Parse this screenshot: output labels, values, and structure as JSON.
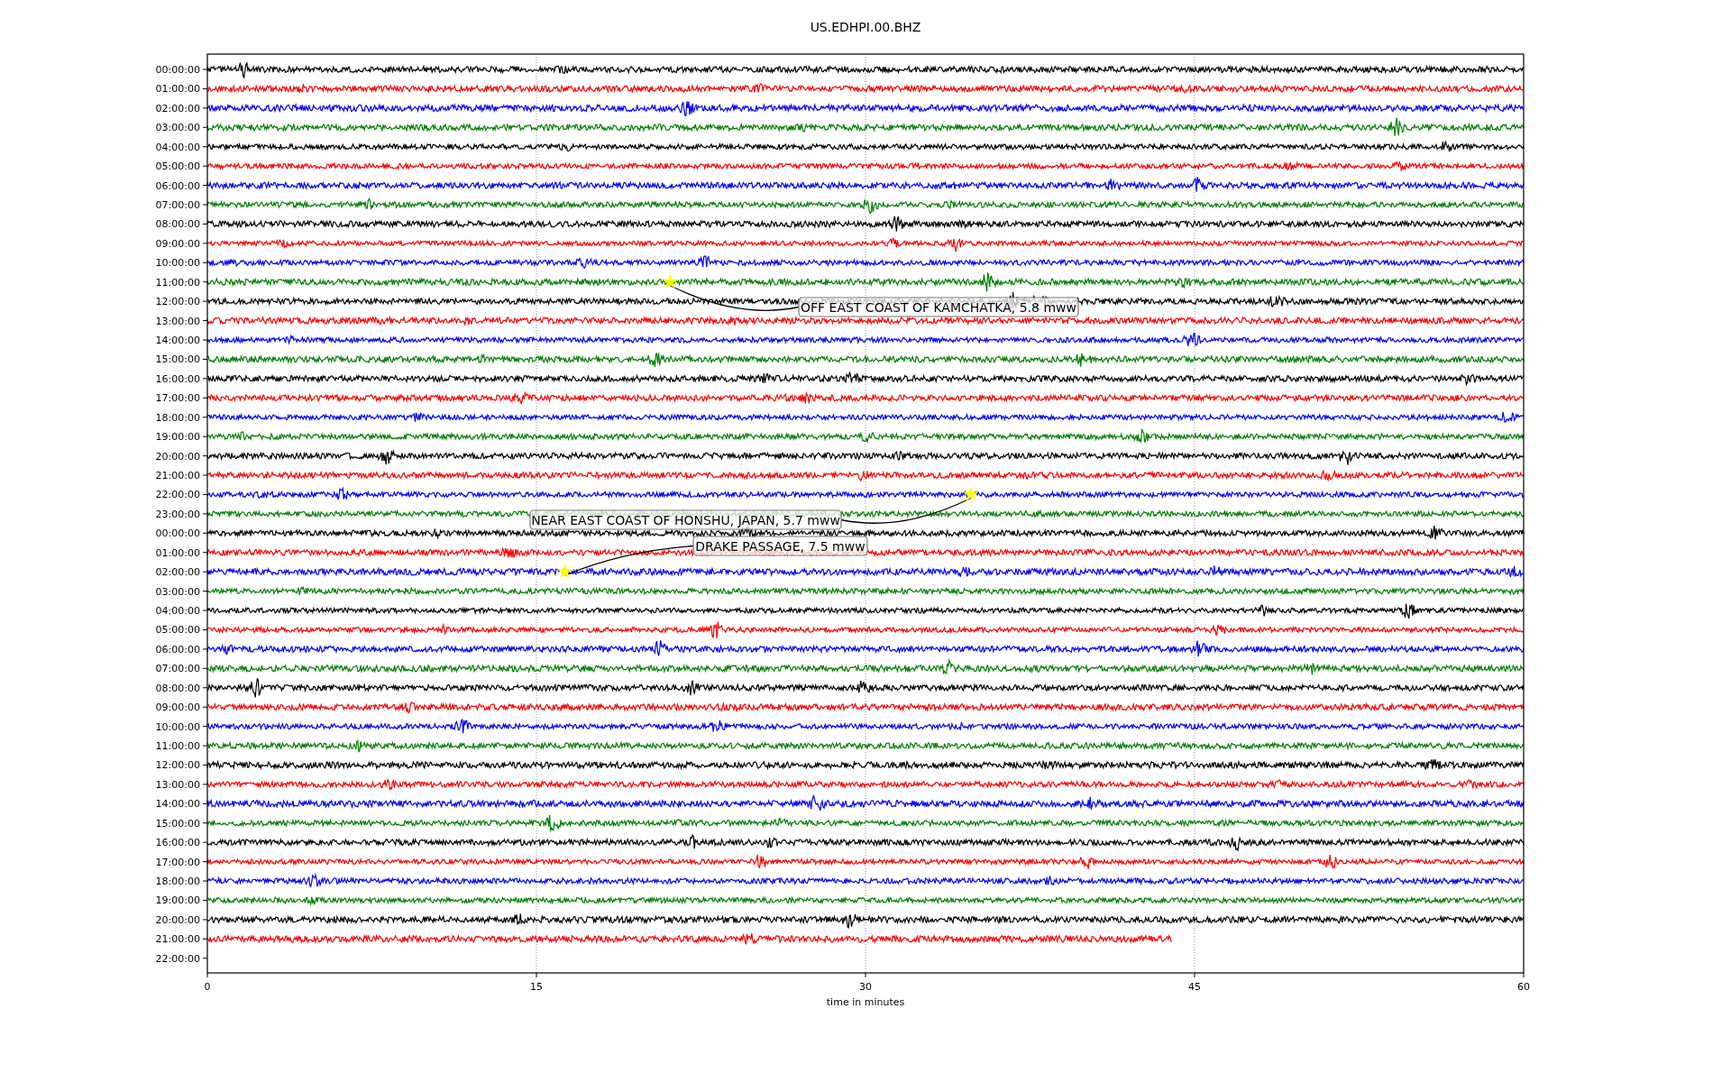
{
  "title": "US.EDHPI.00.BHZ",
  "x_axis": {
    "label": "time in minutes",
    "ticks": [
      "0",
      "15",
      "30",
      "45",
      "60"
    ]
  },
  "traces": [
    {
      "label": "00:00:00",
      "color": "#000000",
      "level": 1
    },
    {
      "label": "01:00:00",
      "color": "#ff0000",
      "level": 1
    },
    {
      "label": "02:00:00",
      "color": "#0000ff",
      "level": 1
    },
    {
      "label": "03:00:00",
      "color": "#008000",
      "level": 1
    },
    {
      "label": "04:00:00",
      "color": "#000000",
      "level": 1
    },
    {
      "label": "05:00:00",
      "color": "#ff0000",
      "level": 1
    },
    {
      "label": "06:00:00",
      "color": "#0000ff",
      "level": 1
    },
    {
      "label": "07:00:00",
      "color": "#008000",
      "level": 1
    },
    {
      "label": "08:00:00",
      "color": "#000000",
      "level": 1
    },
    {
      "label": "09:00:00",
      "color": "#ff0000",
      "level": 1
    },
    {
      "label": "10:00:00",
      "color": "#0000ff",
      "level": 1
    },
    {
      "label": "11:00:00",
      "color": "#008000",
      "level": 1
    },
    {
      "label": "12:00:00",
      "color": "#000000",
      "level": 1
    },
    {
      "label": "13:00:00",
      "color": "#ff0000",
      "level": 1
    },
    {
      "label": "14:00:00",
      "color": "#0000ff",
      "level": 1
    },
    {
      "label": "15:00:00",
      "color": "#008000",
      "level": 1
    },
    {
      "label": "16:00:00",
      "color": "#000000",
      "level": 1
    },
    {
      "label": "17:00:00",
      "color": "#ff0000",
      "level": 1
    },
    {
      "label": "18:00:00",
      "color": "#0000ff",
      "level": 1
    },
    {
      "label": "19:00:00",
      "color": "#008000",
      "level": 1
    },
    {
      "label": "20:00:00",
      "color": "#000000",
      "level": 1
    },
    {
      "label": "21:00:00",
      "color": "#ff0000",
      "level": 1
    },
    {
      "label": "22:00:00",
      "color": "#0000ff",
      "level": 1
    },
    {
      "label": "23:00:00",
      "color": "#008000",
      "level": 1
    },
    {
      "label": "00:00:00",
      "color": "#000000",
      "level": 1
    },
    {
      "label": "01:00:00",
      "color": "#ff0000",
      "level": 1
    },
    {
      "label": "02:00:00",
      "color": "#0000ff",
      "level": 1
    },
    {
      "label": "03:00:00",
      "color": "#008000",
      "level": 1
    },
    {
      "label": "04:00:00",
      "color": "#000000",
      "level": 1
    },
    {
      "label": "05:00:00",
      "color": "#ff0000",
      "level": 1
    },
    {
      "label": "06:00:00",
      "color": "#0000ff",
      "level": 1
    },
    {
      "label": "07:00:00",
      "color": "#008000",
      "level": 1
    },
    {
      "label": "08:00:00",
      "color": "#000000",
      "level": 1
    },
    {
      "label": "09:00:00",
      "color": "#ff0000",
      "level": 1
    },
    {
      "label": "10:00:00",
      "color": "#0000ff",
      "level": 1
    },
    {
      "label": "11:00:00",
      "color": "#008000",
      "level": 1
    },
    {
      "label": "12:00:00",
      "color": "#000000",
      "level": 1
    },
    {
      "label": "13:00:00",
      "color": "#ff0000",
      "level": 1
    },
    {
      "label": "14:00:00",
      "color": "#0000ff",
      "level": 1
    },
    {
      "label": "15:00:00",
      "color": "#008000",
      "level": 1
    },
    {
      "label": "16:00:00",
      "color": "#000000",
      "level": 1
    },
    {
      "label": "17:00:00",
      "color": "#ff0000",
      "level": 1
    },
    {
      "label": "18:00:00",
      "color": "#0000ff",
      "level": 1
    },
    {
      "label": "19:00:00",
      "color": "#008000",
      "level": 1
    },
    {
      "label": "20:00:00",
      "color": "#000000",
      "level": 1
    },
    {
      "label": "21:00:00",
      "color": "#ff0000",
      "level": 0.733
    },
    {
      "label": "22:00:00"
    }
  ],
  "events": [
    {
      "text": "OFF EAST COAST OF KAMCHATKA, 5.8 mww"
    },
    {
      "text": "NEAR EAST COAST OF HONSHU, JAPAN, 5.7 mww"
    },
    {
      "text": "DRAKE PASSAGE, 7.5 mww"
    }
  ]
}
